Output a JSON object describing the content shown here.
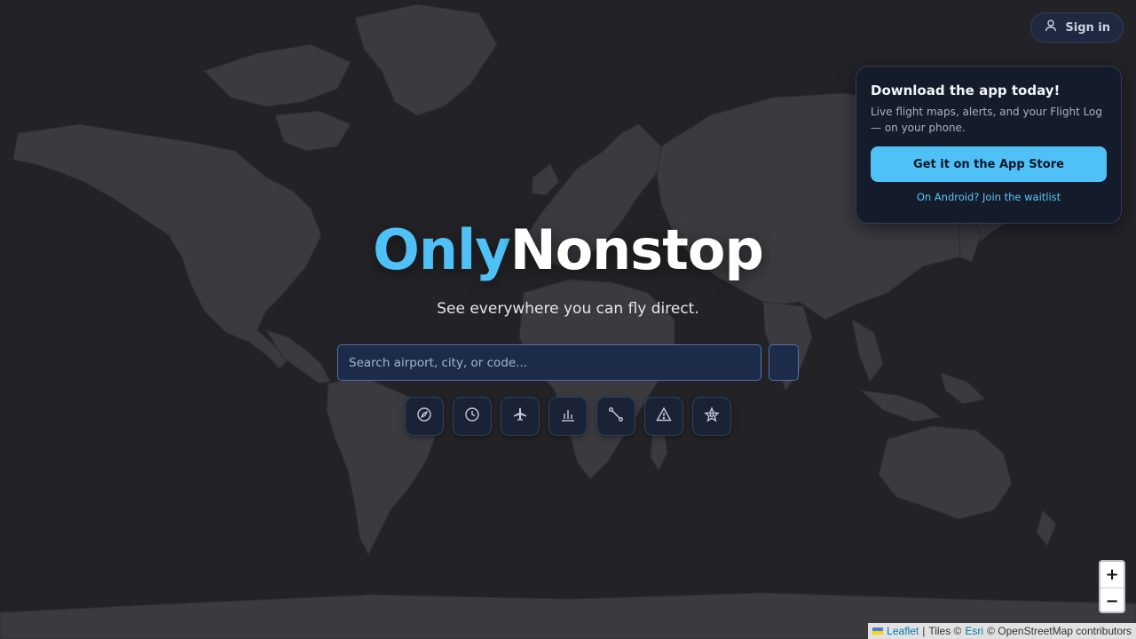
{
  "auth": {
    "sign_in_label": "Sign in"
  },
  "promo": {
    "title": "Download the app today!",
    "description": "Live flight maps, alerts, and your Flight Log — on your phone.",
    "app_store_label": "Get it on the App Store",
    "android_label": "On Android? Join the waitlist"
  },
  "hero": {
    "logo_part1": "Only",
    "logo_part2": "Nonstop",
    "tagline": "See everywhere you can fly direct."
  },
  "search": {
    "placeholder": "Search airport, city, or code..."
  },
  "tools": [
    {
      "icon": "compass-icon"
    },
    {
      "icon": "clock-icon"
    },
    {
      "icon": "plane-icon"
    },
    {
      "icon": "bar-chart-icon"
    },
    {
      "icon": "route-icon"
    },
    {
      "icon": "warning-icon"
    },
    {
      "icon": "star-badge-icon"
    }
  ],
  "map": {
    "zoom_in": "+",
    "zoom_out": "−",
    "attribution": {
      "leaflet": "Leaflet",
      "sep": "|",
      "tiles": "Tiles ©",
      "esri": "Esri",
      "osm": "© OpenStreetMap contributors"
    }
  },
  "colors": {
    "accent": "#4fc1f6",
    "panel": "#141b2b",
    "map_bg": "#232327",
    "land": "#3a3a3f"
  }
}
